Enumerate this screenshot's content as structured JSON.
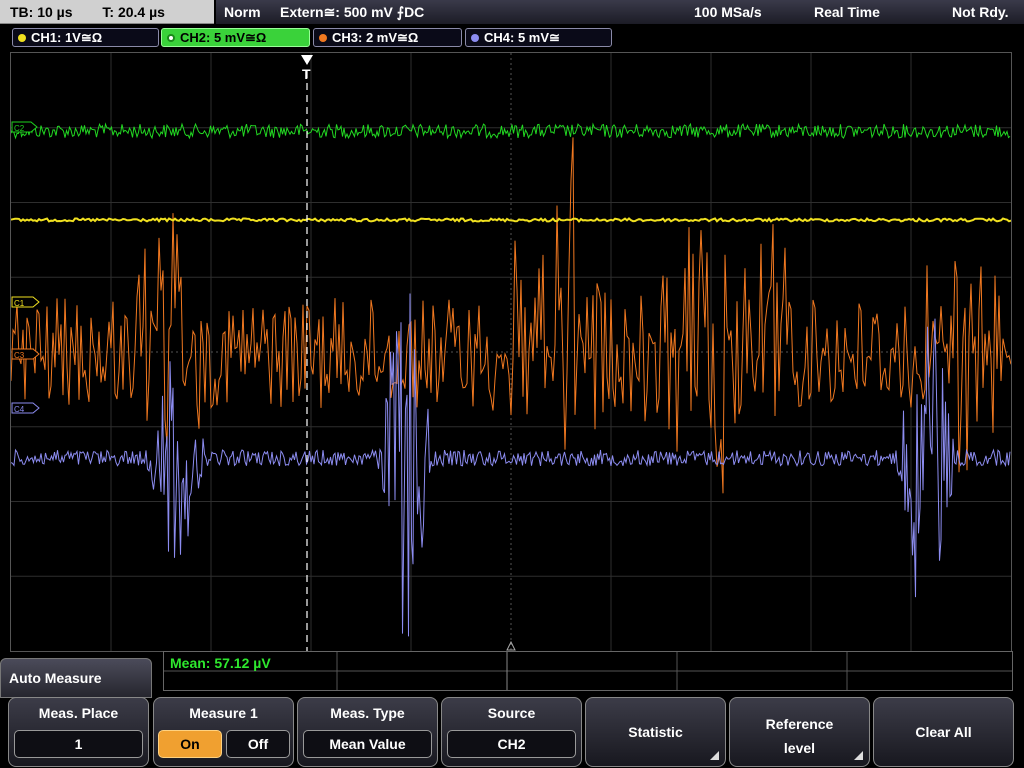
{
  "topbar": {
    "timebase": "TB: 10 µs",
    "trigger_time": "T: 20.4 µs",
    "mode": "Norm",
    "trigger": "Extern≅: 500 mV ⨍DC",
    "sample_rate": "100 MSa/s",
    "acq_mode": "Real Time",
    "status": "Not Rdy."
  },
  "channels": [
    {
      "label": "CH1: 1V≅Ω",
      "color": "#f0e020"
    },
    {
      "label": "CH2: 5 mV≅Ω",
      "color": "#1ed21e"
    },
    {
      "label": "CH3: 2 mV≅Ω",
      "color": "#f07820"
    },
    {
      "label": "CH4: 5 mV≅",
      "color": "#8c8cf0"
    }
  ],
  "markers": {
    "c1": "C1",
    "c2": "C2",
    "c3": "C3",
    "c4": "C4",
    "trigger": "T"
  },
  "measurement": {
    "result": "Mean: 57.12 µV"
  },
  "menu": {
    "title": "Auto Measure",
    "meas_place": {
      "label": "Meas. Place",
      "value": "1"
    },
    "measure1": {
      "label": "Measure 1",
      "on": "On",
      "off": "Off",
      "selected": "On"
    },
    "meas_type": {
      "label": "Meas. Type",
      "value": "Mean Value"
    },
    "source": {
      "label": "Source",
      "value": "CH2"
    },
    "statistic": {
      "label": "Statistic"
    },
    "reference": {
      "label1": "Reference",
      "label2": "level"
    },
    "clear_all": {
      "label": "Clear All"
    }
  }
}
